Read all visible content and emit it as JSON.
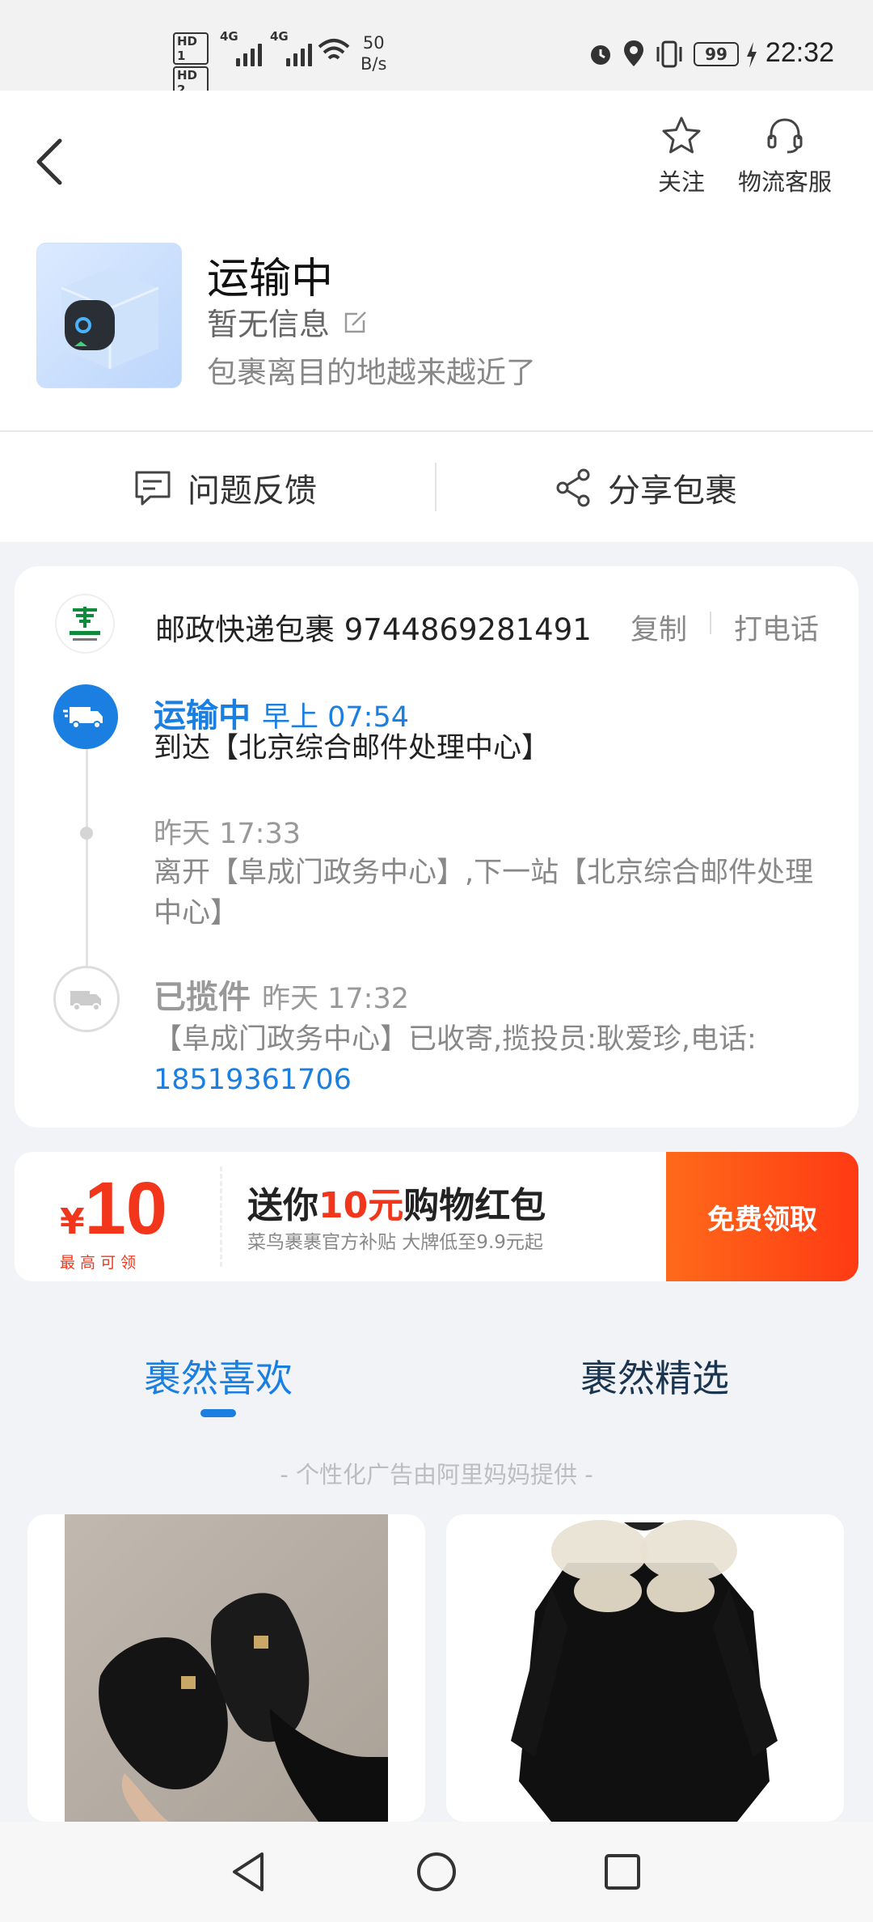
{
  "status_bar": {
    "sim1": "HD 1",
    "sim2": "HD 2",
    "net1": "4G",
    "net2": "4G",
    "speed_value": "50",
    "speed_unit": "B/s",
    "battery": "99",
    "time": "22:32"
  },
  "header": {
    "follow_label": "关注",
    "service_label": "物流客服",
    "status_title": "运输中",
    "status_sub": "暂无信息",
    "status_desc": "包裹离目的地越来越近了"
  },
  "actions": {
    "feedback_label": "问题反馈",
    "share_label": "分享包裹"
  },
  "tracking": {
    "carrier_name": "邮政快递包裹 9744869281491",
    "copy_label": "复制",
    "call_label": "打电话",
    "events": [
      {
        "status": "运输中",
        "time": "早上 07:54",
        "text": "到达【北京综合邮件处理中心】"
      },
      {
        "status": "",
        "time": "昨天  17:33",
        "text": "离开【阜成门政务中心】,下一站【北京综合邮件处理中心】"
      },
      {
        "status": "已揽件",
        "time": "昨天  17:32",
        "text": "【阜成门政务中心】已收寄,揽投员:耿爱珍,电话:",
        "phone": "18519361706"
      }
    ]
  },
  "promo": {
    "currency": "¥",
    "amount": "10",
    "amount_note": "最 高 可 领",
    "title_pre": "送你",
    "title_amount": "10元",
    "title_post": "购物红包",
    "subtitle": "菜鸟裹裹官方补贴 大牌低至9.9元起",
    "cta": "免费领取"
  },
  "tabs": {
    "tab1": "裹然喜欢",
    "tab2": "裹然精选",
    "ad_note": "- 个性化广告由阿里妈妈提供 -"
  },
  "colors": {
    "accent": "#1a7fe0",
    "promo_red": "#f2361c",
    "promo_orange": "#ff5a14"
  }
}
